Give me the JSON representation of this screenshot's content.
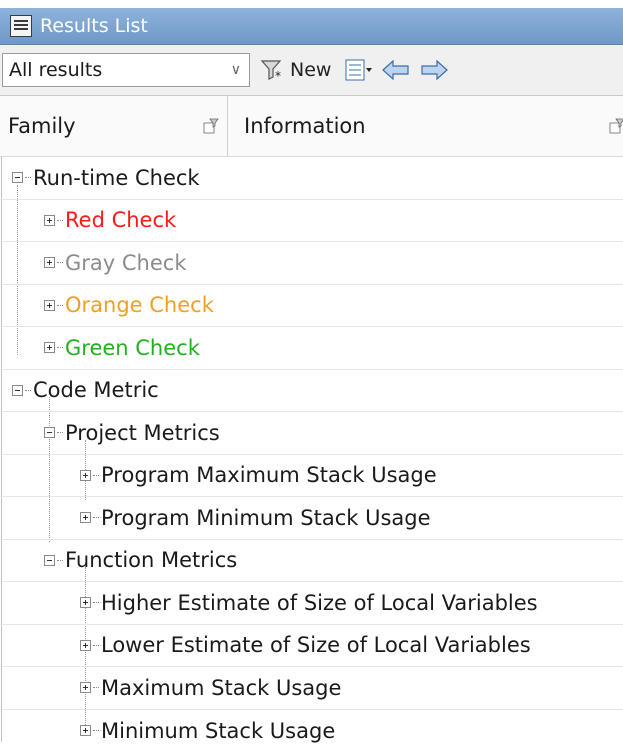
{
  "window": {
    "title": "Results List"
  },
  "toolbar": {
    "filter_value": "All results",
    "new_label": "New",
    "icons": [
      "new-filter-icon",
      "column-layout-icon",
      "back-arrow-icon",
      "forward-arrow-icon"
    ]
  },
  "columns": {
    "family": "Family",
    "information": "Information"
  },
  "tree": {
    "runtime_check": {
      "label": "Run-time Check",
      "children": {
        "red": "Red Check",
        "gray": "Gray Check",
        "orange": "Orange Check",
        "green": "Green Check"
      }
    },
    "code_metric": {
      "label": "Code Metric",
      "project_metrics": {
        "label": "Project Metrics",
        "items": [
          "Program Maximum Stack Usage",
          "Program Minimum Stack Usage"
        ]
      },
      "function_metrics": {
        "label": "Function Metrics",
        "items": [
          "Higher Estimate of Size of Local Variables",
          "Lower Estimate of Size of Local Variables",
          "Maximum Stack Usage",
          "Minimum Stack Usage"
        ]
      }
    }
  },
  "colors": {
    "red": "#ff1a1a",
    "gray": "#8c8c8c",
    "orange": "#f0a020",
    "green": "#22b022",
    "titlebar": "#7fa6d3"
  }
}
